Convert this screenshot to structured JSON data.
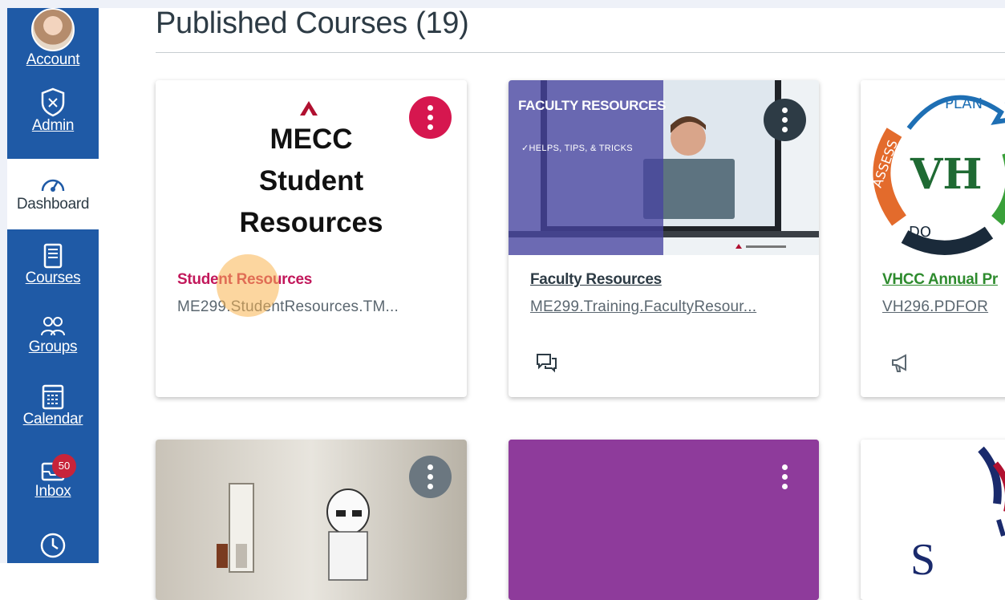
{
  "nav": {
    "account": "Account",
    "admin": "Admin",
    "dashboard": "Dashboard",
    "courses": "Courses",
    "groups": "Groups",
    "calendar": "Calendar",
    "inbox": "Inbox",
    "inbox_badge": "50"
  },
  "page_title": "Published Courses (19)",
  "cards": [
    {
      "hero_lines": [
        "MECC",
        "Student",
        "Resources"
      ],
      "title": "Student Resources",
      "code": "ME299.StudentResources.TM...",
      "accent": "#d6174f",
      "title_color": "#c2185b"
    },
    {
      "hero_title": "FACULTY RESOURCES",
      "hero_sub": "✓HELPS, TIPS, & TRICKS",
      "title": "Faculty Resources",
      "code": "ME299.Training.FacultyResour...",
      "accent": "#2d3b45",
      "title_color": "#2d3b45"
    },
    {
      "hero_words": [
        "PLAN",
        "ASSESS",
        "DO",
        "VH"
      ],
      "title": "VHCC Annual Pr",
      "code": "VH296.PDFOR",
      "title_color": "#2e8b2e"
    },
    {
      "accent": "#6b7780"
    },
    {
      "accent": "#8e3b9b"
    },
    {
      "hero_text": "S"
    }
  ]
}
